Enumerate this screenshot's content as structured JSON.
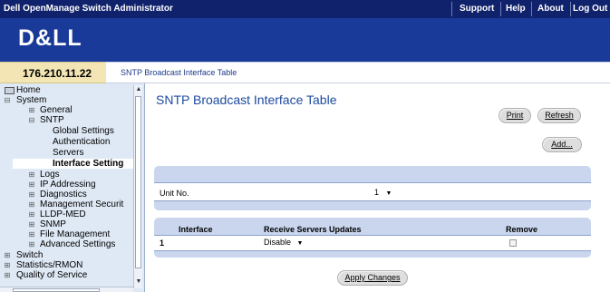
{
  "header": {
    "app_title": "Dell OpenManage Switch Administrator",
    "nav": [
      "Support",
      "Help",
      "About",
      "Log Out"
    ],
    "logo_text": "D&LL"
  },
  "ip_address": "176.210.11.22",
  "breadcrumb": "SNTP Broadcast Interface Table",
  "sidebar": {
    "items": [
      {
        "label": "Home"
      },
      {
        "label": "System"
      },
      {
        "label": "General"
      },
      {
        "label": "SNTP"
      },
      {
        "label": "Global Settings"
      },
      {
        "label": "Authentication"
      },
      {
        "label": "Servers"
      },
      {
        "label": "Interface Setting"
      },
      {
        "label": "Logs"
      },
      {
        "label": "IP Addressing"
      },
      {
        "label": "Diagnostics"
      },
      {
        "label": "Management Securit"
      },
      {
        "label": "LLDP-MED"
      },
      {
        "label": "SNMP"
      },
      {
        "label": "File Management"
      },
      {
        "label": "Advanced Settings"
      },
      {
        "label": "Switch"
      },
      {
        "label": "Statistics/RMON"
      },
      {
        "label": "Quality of Service"
      }
    ]
  },
  "page": {
    "title": "SNTP Broadcast Interface Table",
    "print_label": "Print",
    "refresh_label": "Refresh",
    "add_label": "Add..."
  },
  "unit": {
    "label": "Unit No.",
    "value": "1"
  },
  "table": {
    "headers": {
      "interface": "Interface",
      "receive": "Receive Servers Updates",
      "remove": "Remove"
    },
    "rows": [
      {
        "index": "1",
        "interface": "",
        "receive": "Disable",
        "remove": false
      }
    ]
  },
  "apply_label": "Apply Changes",
  "colors": {
    "topbar": "#10226b",
    "brand": "#1a3a9a",
    "title": "#1d4aa0",
    "panel": "#c9d6ee"
  }
}
